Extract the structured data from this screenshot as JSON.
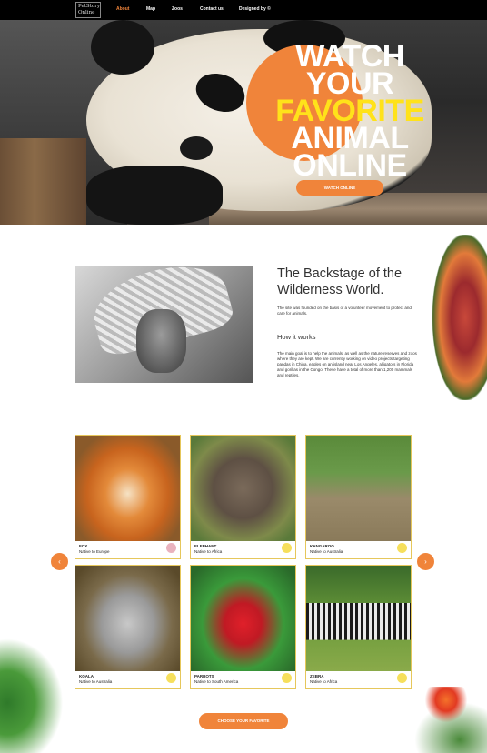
{
  "nav": {
    "logo_line1": "PetStory",
    "logo_line2": "Online",
    "items": [
      "About",
      "Map",
      "Zoos",
      "Contact us",
      "Designed by ©"
    ]
  },
  "hero": {
    "line1": "WATCH",
    "line2": "YOUR",
    "line3": "FAVORITE",
    "line4": "ANIMAL",
    "line5": "ONLINE",
    "button": "WATCH ONLINE"
  },
  "about": {
    "title": "The Backstage of the Wilderness World.",
    "intro": "The site was founded on the basis of a volunteer movement to protect and care for animals.",
    "how_title": "How it works",
    "how_text": "The main goal is to help the animals, as well as the nature reserves and zoos where they are kept. We are currently working on video projects targeting pandas in China, eagles on an island near Los Angeles, alligators in Florida and gorillas in the Congo. These have a total of more than 1,200 mammals and reptiles."
  },
  "animals": [
    {
      "name": "FOX",
      "origin": "Native to Europe"
    },
    {
      "name": "ELEPHANT",
      "origin": "Native to Africa"
    },
    {
      "name": "KANGAROO",
      "origin": "Native to Australia"
    },
    {
      "name": "KOALA",
      "origin": "Native to Australia"
    },
    {
      "name": "PARROTS",
      "origin": "Native to South America"
    },
    {
      "name": "ZEBRA",
      "origin": "Native to Africa"
    }
  ],
  "arrows": {
    "prev": "‹",
    "next": "›"
  },
  "choose_button": "CHOOSE YOUR FAVORITE",
  "colors": {
    "accent": "#f0843a",
    "highlight": "#ffe21a",
    "card_border": "#e6c75b"
  }
}
